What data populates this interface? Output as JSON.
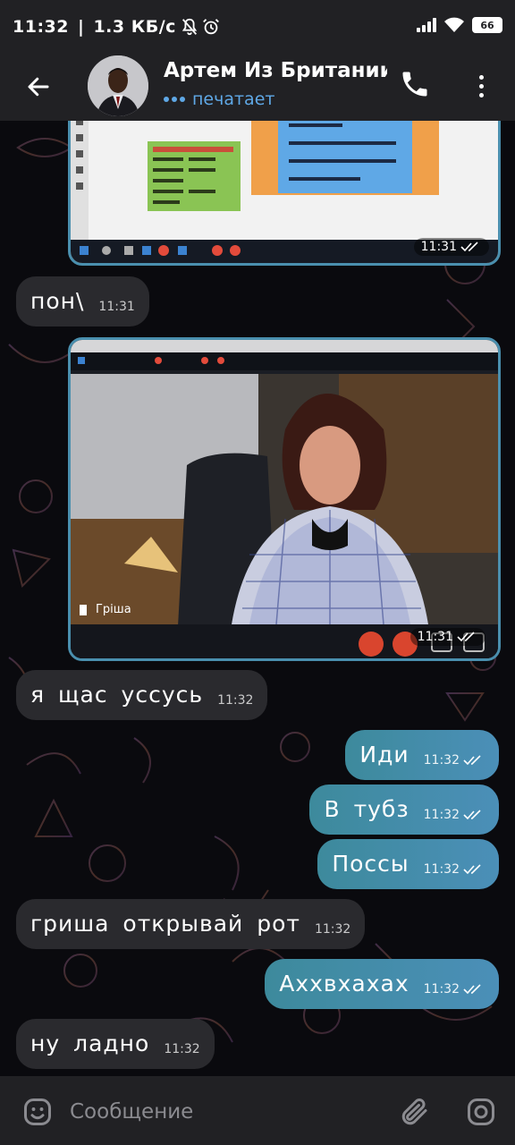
{
  "status_bar": {
    "time": "11:32",
    "separator": "|",
    "speed": "1.3  КБ/с",
    "battery": "66",
    "icons": [
      "bell-muted-icon",
      "alarm-icon",
      "signal-icon",
      "wifi-icon",
      "battery-icon"
    ]
  },
  "header": {
    "title": "Артем Из Британии",
    "status": "печатает",
    "icons": [
      "back-arrow-icon",
      "phone-icon",
      "more-vertical-icon"
    ]
  },
  "messages": [
    {
      "direction": "out",
      "type": "photo",
      "time": "11:31",
      "description_icon": "screenshot-presentation"
    },
    {
      "direction": "in",
      "type": "text",
      "text": "пон\\",
      "time": "11:31"
    },
    {
      "direction": "out",
      "type": "photo",
      "time": "11:31",
      "description_icon": "screenshot-video-call",
      "caption_in_image": "Гріша"
    },
    {
      "direction": "in",
      "type": "text",
      "text": "я щас уссусь",
      "time": "11:32"
    },
    {
      "direction": "out",
      "type": "text",
      "text": "Иди",
      "time": "11:32"
    },
    {
      "direction": "out",
      "type": "text",
      "text": "В тубз",
      "time": "11:32"
    },
    {
      "direction": "out",
      "type": "text",
      "text": "Поссы",
      "time": "11:32"
    },
    {
      "direction": "in",
      "type": "text",
      "text": "гриша открывай рот",
      "time": "11:32"
    },
    {
      "direction": "out",
      "type": "text",
      "text": "Аххвхахах",
      "time": "11:32"
    },
    {
      "direction": "in",
      "type": "text",
      "text": "ну ладно",
      "time": "11:32"
    }
  ],
  "input_bar": {
    "placeholder": "Сообщение",
    "icons": [
      "emoji-icon",
      "attach-icon",
      "camera-icon"
    ]
  },
  "colors": {
    "background": "#0a0a0e",
    "bars": "#212124",
    "incoming_bubble": "#2a2a2e",
    "outgoing_bubble_start": "#3d8a9c",
    "outgoing_bubble_end": "#4b8fb8",
    "accent": "#5fa8e6"
  }
}
